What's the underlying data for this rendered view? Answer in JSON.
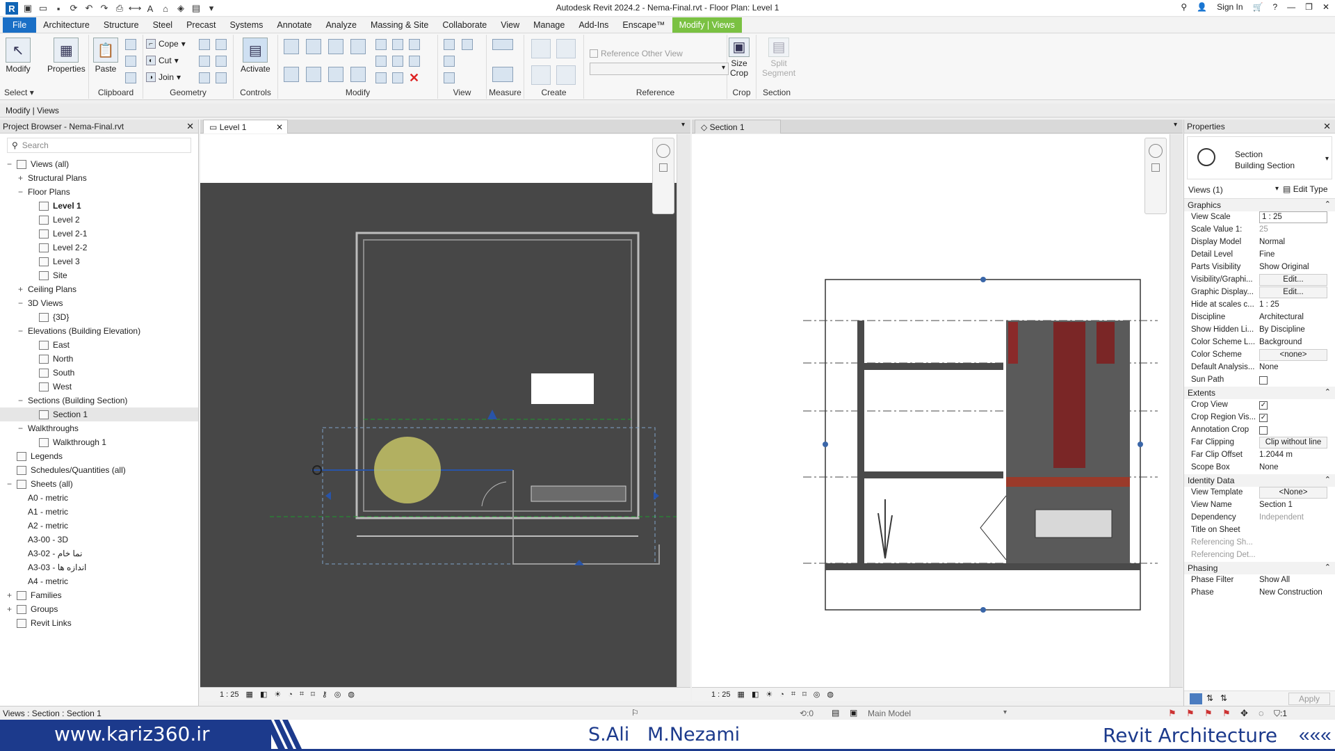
{
  "title": "Autodesk Revit 2024.2 - Nema-Final.rvt - Floor Plan: Level 1",
  "titlebar": {
    "sign_in": "Sign In"
  },
  "menu": [
    "File",
    "Architecture",
    "Structure",
    "Steel",
    "Precast",
    "Systems",
    "Annotate",
    "Analyze",
    "Massing & Site",
    "Collaborate",
    "View",
    "Manage",
    "Add-Ins",
    "Enscape™",
    "Modify | Views"
  ],
  "ribbon": {
    "modify": "Modify",
    "select": "Select",
    "properties": "Properties",
    "paste": "Paste",
    "clipboard": "Clipboard",
    "cope": "Cope",
    "cut": "Cut",
    "join": "Join",
    "geometry": "Geometry",
    "activate": "Activate",
    "controls": "Controls",
    "modify_panel": "Modify",
    "view": "View",
    "measure": "Measure",
    "create": "Create",
    "reference_other_view": "Reference Other View",
    "reference": "Reference",
    "size_crop_1": "Size",
    "size_crop_2": "Crop",
    "crop": "Crop",
    "split_1": "Split",
    "split_2": "Segment",
    "section": "Section"
  },
  "context": "Modify | Views",
  "project_browser": {
    "title": "Project Browser - Nema-Final.rvt",
    "search_placeholder": "Search",
    "items": [
      {
        "label": "Views (all)",
        "level": 0,
        "toggle": "−",
        "icon": true
      },
      {
        "label": "Structural Plans",
        "level": 1,
        "toggle": "+"
      },
      {
        "label": "Floor Plans",
        "level": 1,
        "toggle": "−"
      },
      {
        "label": "Level 1",
        "level": 2,
        "icon": true,
        "bold": true
      },
      {
        "label": "Level 2",
        "level": 2,
        "icon": true
      },
      {
        "label": "Level 2-1",
        "level": 2,
        "icon": true
      },
      {
        "label": "Level 2-2",
        "level": 2,
        "icon": true
      },
      {
        "label": "Level 3",
        "level": 2,
        "icon": true
      },
      {
        "label": "Site",
        "level": 2,
        "icon": true
      },
      {
        "label": "Ceiling Plans",
        "level": 1,
        "toggle": "+"
      },
      {
        "label": "3D Views",
        "level": 1,
        "toggle": "−"
      },
      {
        "label": "{3D}",
        "level": 2,
        "icon": true
      },
      {
        "label": "Elevations (Building Elevation)",
        "level": 1,
        "toggle": "−"
      },
      {
        "label": "East",
        "level": 2,
        "icon": true
      },
      {
        "label": "North",
        "level": 2,
        "icon": true
      },
      {
        "label": "South",
        "level": 2,
        "icon": true
      },
      {
        "label": "West",
        "level": 2,
        "icon": true
      },
      {
        "label": "Sections (Building Section)",
        "level": 1,
        "toggle": "−"
      },
      {
        "label": "Section 1",
        "level": 2,
        "icon": true,
        "selected": true
      },
      {
        "label": "Walkthroughs",
        "level": 1,
        "toggle": "−"
      },
      {
        "label": "Walkthrough 1",
        "level": 2,
        "icon": true
      },
      {
        "label": "Legends",
        "level": 0,
        "icon": true
      },
      {
        "label": "Schedules/Quantities (all)",
        "level": 0,
        "icon": true
      },
      {
        "label": "Sheets (all)",
        "level": 0,
        "toggle": "−",
        "icon": true
      },
      {
        "label": "A0 - metric",
        "level": 1
      },
      {
        "label": "A1 - metric",
        "level": 1
      },
      {
        "label": "A2 - metric",
        "level": 1
      },
      {
        "label": "A3-00 - 3D",
        "level": 1
      },
      {
        "label": "A3-02 - نما خام",
        "level": 1
      },
      {
        "label": "A3-03 - اندازه ها",
        "level": 1
      },
      {
        "label": "A4 - metric",
        "level": 1
      },
      {
        "label": "Families",
        "level": 0,
        "toggle": "+",
        "icon": true
      },
      {
        "label": "Groups",
        "level": 0,
        "toggle": "+",
        "icon": true
      },
      {
        "label": "Revit Links",
        "level": 0,
        "icon": true
      }
    ]
  },
  "views": {
    "level1_tab": "Level 1",
    "section1_tab": "Section 1",
    "scale_left": "1 : 25",
    "scale_right": "1 : 25"
  },
  "properties": {
    "title": "Properties",
    "type_1": "Section",
    "type_2": "Building Section",
    "selector": "Views (1)",
    "edit_type": "Edit Type",
    "groups": [
      {
        "name": "Graphics",
        "rows": [
          {
            "k": "View Scale",
            "v": "1 : 25",
            "style": "box"
          },
          {
            "k": "Scale Value    1:",
            "v": "25",
            "style": "gray"
          },
          {
            "k": "Display Model",
            "v": "Normal"
          },
          {
            "k": "Detail Level",
            "v": "Fine"
          },
          {
            "k": "Parts Visibility",
            "v": "Show Original"
          },
          {
            "k": "Visibility/Graphi...",
            "v": "Edit...",
            "style": "btn"
          },
          {
            "k": "Graphic Display...",
            "v": "Edit...",
            "style": "btn"
          },
          {
            "k": "Hide at scales c...",
            "v": "1 : 25"
          },
          {
            "k": "Discipline",
            "v": "Architectural"
          },
          {
            "k": "Show Hidden Li...",
            "v": "By Discipline"
          },
          {
            "k": "Color Scheme L...",
            "v": "Background"
          },
          {
            "k": "Color Scheme",
            "v": "<none>",
            "style": "btn"
          },
          {
            "k": "Default Analysis...",
            "v": "None"
          },
          {
            "k": "Sun Path",
            "v": "",
            "style": "chk"
          }
        ]
      },
      {
        "name": "Extents",
        "rows": [
          {
            "k": "Crop View",
            "v": "✓",
            "style": "chk"
          },
          {
            "k": "Crop Region Vis...",
            "v": "✓",
            "style": "chk"
          },
          {
            "k": "Annotation Crop",
            "v": "",
            "style": "chk"
          },
          {
            "k": "Far Clipping",
            "v": "Clip without line",
            "style": "btn"
          },
          {
            "k": "Far Clip Offset",
            "v": "1.2044 m"
          },
          {
            "k": "Scope Box",
            "v": "None"
          }
        ]
      },
      {
        "name": "Identity Data",
        "rows": [
          {
            "k": "View Template",
            "v": "<None>",
            "style": "btn"
          },
          {
            "k": "View Name",
            "v": "Section 1"
          },
          {
            "k": "Dependency",
            "v": "Independent",
            "style": "gray"
          },
          {
            "k": "Title on Sheet",
            "v": ""
          },
          {
            "k": "Referencing Sh...",
            "v": "",
            "style": "graykey"
          },
          {
            "k": "Referencing Det...",
            "v": "",
            "style": "graykey"
          }
        ]
      },
      {
        "name": "Phasing",
        "rows": [
          {
            "k": "Phase Filter",
            "v": "Show All"
          },
          {
            "k": "Phase",
            "v": "New Construction"
          }
        ]
      }
    ],
    "apply": "Apply"
  },
  "status": {
    "left": "Views : Section : Section 1",
    "model": "Main Model",
    "filter_count": ":1",
    "sel_count": ":0"
  },
  "banner": {
    "site": "www.kariz360.ir",
    "author": "S.Ali   M.Nezami",
    "course": "Revit Architecture",
    "arrows": "«««"
  }
}
